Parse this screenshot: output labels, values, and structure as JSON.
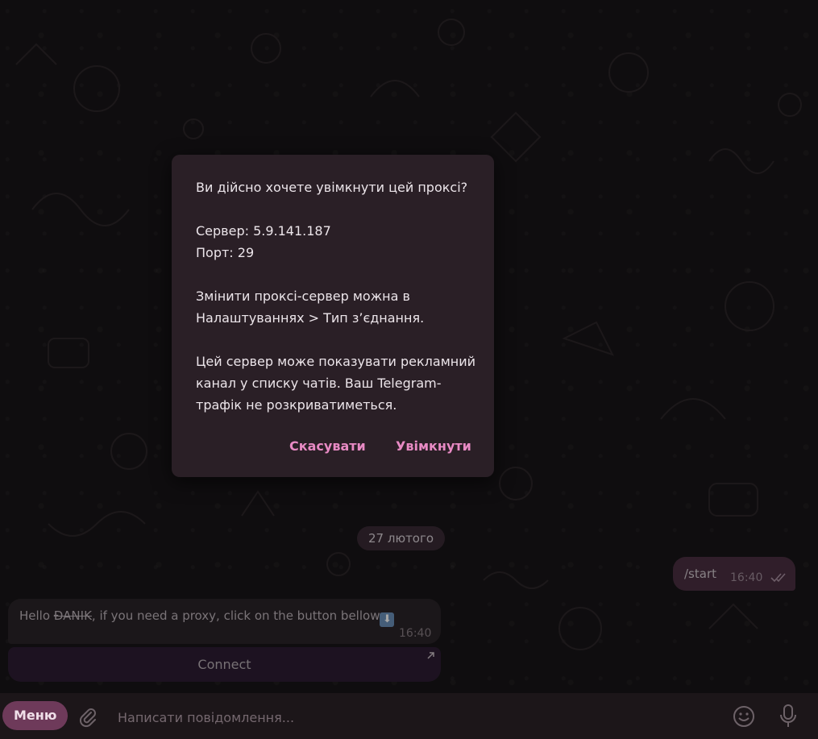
{
  "dialog": {
    "question": "Ви дійсно хочете увімкнути цей проксі?",
    "server": "Сервер: 5.9.141.187",
    "port": "Порт: 29",
    "change_line1": "Змінити проксі-сервер можна в",
    "change_line2": "Налаштуваннях > Тип з’єднання.",
    "notice_line1": "Цей сервер може показувати рекламний",
    "notice_line2": "канал у списку чатів. Ваш Telegram-",
    "notice_line3": "трафік не розкриватиметься.",
    "cancel_label": "Скасувати",
    "enable_label": "Увімкнути"
  },
  "chat": {
    "date_chip": "27 лютого",
    "outgoing": {
      "text": "/start",
      "time": "16:40",
      "status_icon": "double-check-icon"
    },
    "incoming": {
      "text_before": "Hello ",
      "name": "ĐANIK",
      "text_after": ", if you need a proxy, click on the button bellow",
      "emoji": "⬇",
      "time": "16:40"
    },
    "inline_button": {
      "label": "Connect",
      "icon": "open-link-arrow-icon"
    }
  },
  "composer": {
    "menu_label": "Меню",
    "placeholder": "Написати повідомлення...",
    "attach_icon": "paperclip-icon",
    "emoji_icon": "smile-icon",
    "mic_icon": "microphone-icon"
  },
  "colors": {
    "accent": "#e88ac4",
    "menu_button": "#6e3a5a",
    "dialog_bg": "#2a1f26",
    "outgoing_bubble": "#4a2e41",
    "incoming_bubble": "#2a2428"
  }
}
